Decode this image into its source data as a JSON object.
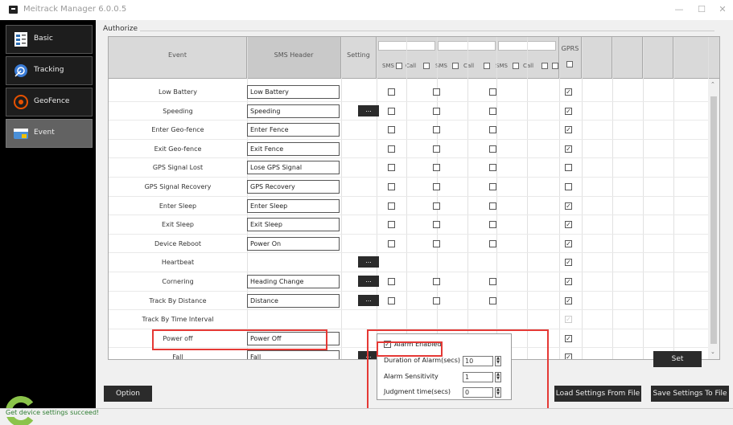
{
  "window": {
    "title": "Meitrack Manager 6.0.0.5",
    "min": "—",
    "max": "☐",
    "close": "✕"
  },
  "sidebar": {
    "items": [
      {
        "label": "Basic",
        "icon": "document-icon"
      },
      {
        "label": "Tracking",
        "icon": "satellite-icon"
      },
      {
        "label": "GeoFence",
        "icon": "geofence-icon"
      },
      {
        "label": "Event",
        "icon": "event-icon"
      }
    ],
    "active": "Event"
  },
  "group": {
    "label": "Authorize"
  },
  "table": {
    "headers": {
      "event": "Event",
      "sms_header": "SMS Header",
      "setting": "Setting",
      "gprs": "GPRS"
    },
    "sub": [
      {
        "sms": "SMS",
        "call": "Call"
      },
      {
        "sms": "SMS",
        "call": "Call"
      },
      {
        "sms": "SMS",
        "call": "Call"
      }
    ],
    "more_label": "...",
    "rows": [
      {
        "name": "Low Battery",
        "header": "Low Battery",
        "more": false,
        "sms": true,
        "gprs": true
      },
      {
        "name": "Speeding",
        "header": "Speeding",
        "more": true,
        "sms": true,
        "gprs": true
      },
      {
        "name": "Enter Geo-fence",
        "header": "Enter Fence",
        "more": false,
        "sms": true,
        "gprs": true
      },
      {
        "name": "Exit Geo-fence",
        "header": "Exit Fence",
        "more": false,
        "sms": true,
        "gprs": true
      },
      {
        "name": "GPS Signal Lost",
        "header": "Lose GPS Signal",
        "more": false,
        "sms": true,
        "gprs": false
      },
      {
        "name": "GPS Signal Recovery",
        "header": "GPS Recovery",
        "more": false,
        "sms": true,
        "gprs": false
      },
      {
        "name": "Enter Sleep",
        "header": "Enter Sleep",
        "more": false,
        "sms": true,
        "gprs": true
      },
      {
        "name": "Exit Sleep",
        "header": "Exit Sleep",
        "more": false,
        "sms": true,
        "gprs": true
      },
      {
        "name": "Device Reboot",
        "header": "Power On",
        "more": false,
        "sms": true,
        "gprs": true
      },
      {
        "name": "Heartbeat",
        "header": "",
        "more": true,
        "sms": false,
        "gprs": true
      },
      {
        "name": "Cornering",
        "header": "Heading Change",
        "more": true,
        "sms": true,
        "gprs": true
      },
      {
        "name": "Track By Distance",
        "header": "Distance",
        "more": true,
        "sms": true,
        "gprs": true
      },
      {
        "name": "Track By Time Interval",
        "header": "",
        "more": false,
        "sms": false,
        "gprs": "disabled"
      },
      {
        "name": "Power off",
        "header": "Power Off",
        "more": false,
        "sms": true,
        "gprs": true
      },
      {
        "name": "Fall",
        "header": "Fall",
        "more": true,
        "sms": true,
        "gprs": true
      }
    ]
  },
  "popup": {
    "alarm_enabled": "Alarm Enabled",
    "duration_label": "Duration of Alarm(secs)",
    "duration_value": "10",
    "sensitivity_label": "Alarm Sensitivity",
    "sensitivity_value": "1",
    "judgment_label": "Judgment time(secs)",
    "judgment_value": "0"
  },
  "buttons": {
    "set": "Set",
    "option": "Option",
    "load": "Load Settings From File",
    "save": "Save Settings To File"
  },
  "status": {
    "text": "Get device settings succeed!"
  },
  "colors": {
    "highlight_red": "#e53935",
    "dark_button": "#2b2b2b",
    "status_green": "#2e7d32"
  }
}
